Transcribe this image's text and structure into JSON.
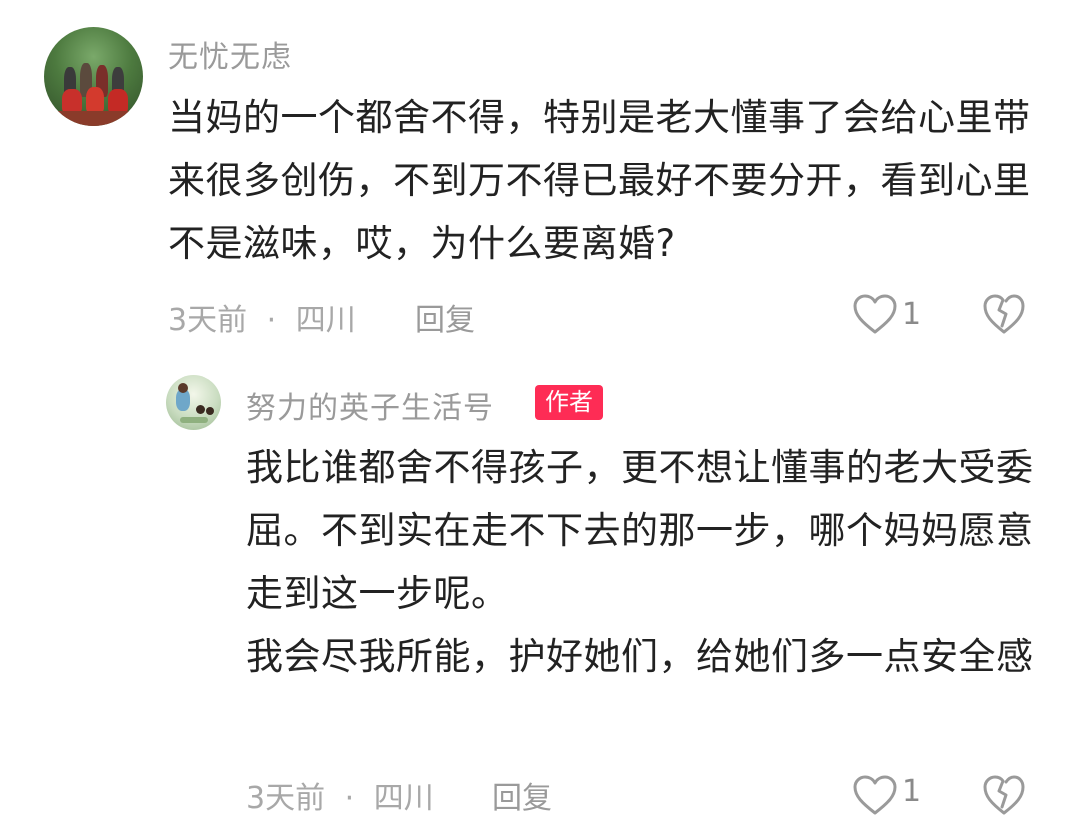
{
  "comment": {
    "username": "无忧无虑",
    "text": "当妈的一个都舍不得，特别是老大懂事了会给心里带来很多创伤，不到万不得已最好不要分开，看到心里不是滋味，哎，为什么要离婚?",
    "time": "3天前",
    "separator": "·",
    "location": "四川",
    "reply_label": "回复",
    "like_count": "1"
  },
  "reply": {
    "username": "努力的英子生活号",
    "badge": "作者",
    "text": "我比谁都舍不得孩子，更不想让懂事的老大受委屈。不到实在走不下去的那一步，哪个妈妈愿意走到这一步呢。\n我会尽我所能，护好她们，给她们多一点安全感",
    "time": "3天前",
    "separator": "·",
    "location": "四川",
    "reply_label": "回复",
    "like_count": "1"
  },
  "colors": {
    "badge_bg": "#fe2c55",
    "meta_text": "#a8a8a8",
    "body_text": "#222222"
  },
  "icons": {
    "like": "heart-outline-icon",
    "dislike": "broken-heart-outline-icon"
  }
}
